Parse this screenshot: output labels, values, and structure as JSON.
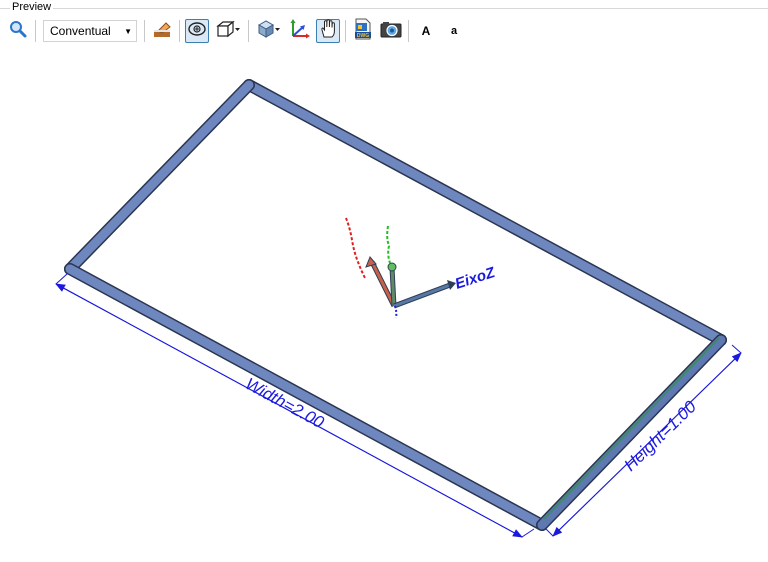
{
  "panel": {
    "title": "Preview"
  },
  "toolbar": {
    "visual_style": "Conventual",
    "font_large_label": "A",
    "font_small_label": "a"
  },
  "viewport": {
    "axis_label": "EixoZ",
    "width_dimension": "Width=2.00",
    "height_dimension": "Height=1.00"
  }
}
